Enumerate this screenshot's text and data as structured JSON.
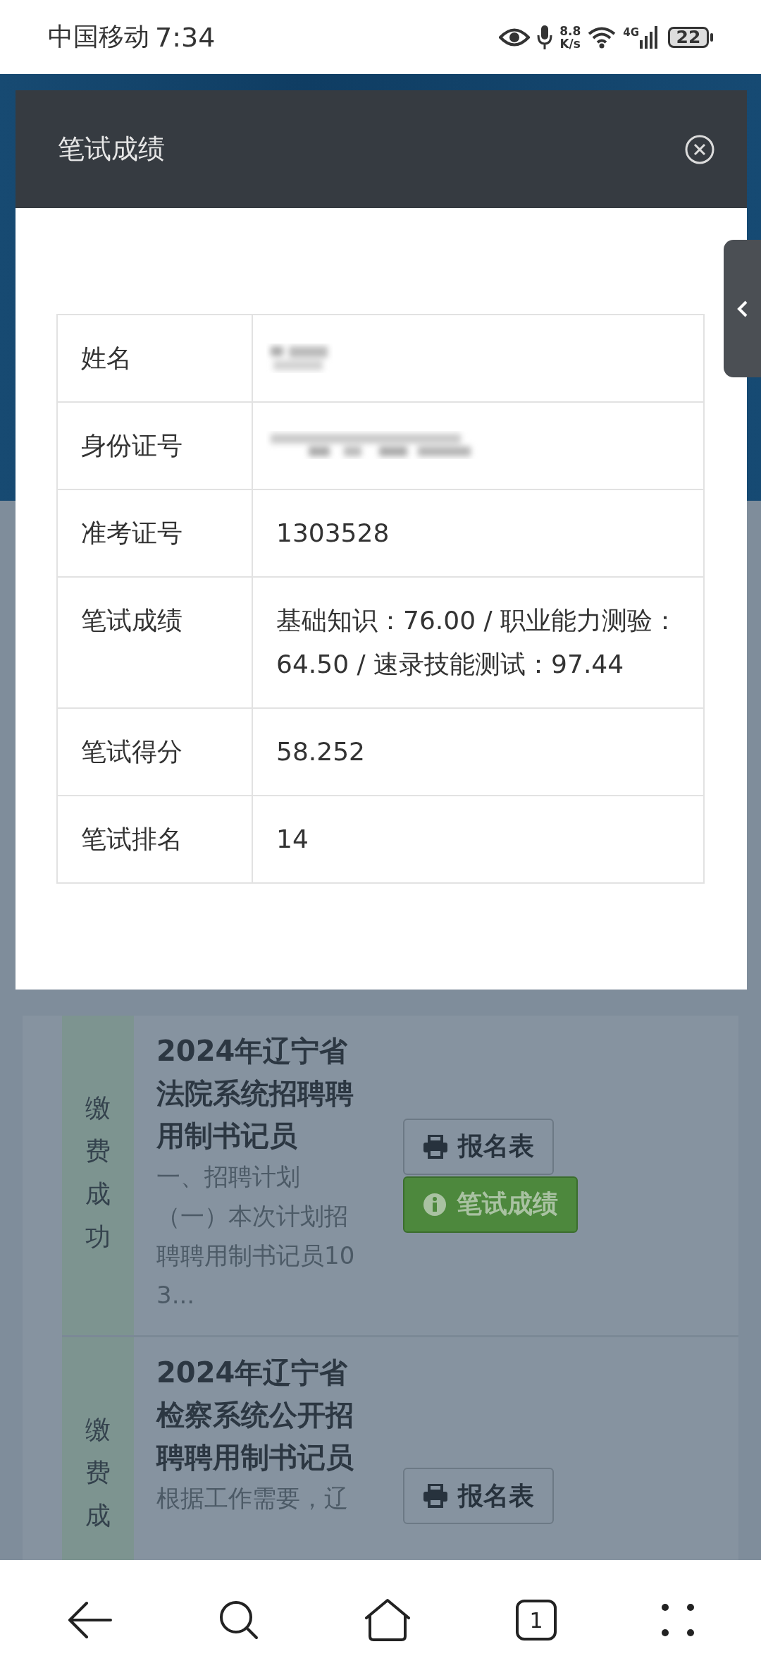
{
  "status_bar": {
    "carrier": "中国移动",
    "time": "7:34",
    "net_speed_value": "8.8",
    "net_speed_unit": "K/s",
    "network": "4G",
    "battery": "22"
  },
  "modal": {
    "title": "笔试成绩",
    "rows": [
      {
        "label": "姓名",
        "redacted": true
      },
      {
        "label": "身份证号",
        "redacted": true
      },
      {
        "label": "准考证号",
        "redacted": false,
        "value": "1303528"
      },
      {
        "label": "笔试成绩",
        "redacted": false,
        "value": "基础知识：76.00 / 职业能力测验：64.50 / 速录技能测试：97.44"
      },
      {
        "label": "笔试得分",
        "redacted": false,
        "value": "58.252"
      },
      {
        "label": "笔试排名",
        "redacted": false,
        "value": "14"
      }
    ]
  },
  "applications": [
    {
      "status": "缴费成功",
      "title": "2024年辽宁省法院系统招聘聘用制书记员",
      "description": [
        "一、招聘计划",
        "（一）本次计划招聘聘用制书记员103..."
      ],
      "buttons": [
        {
          "kind": "form",
          "label": "报名表"
        },
        {
          "kind": "score",
          "label": "笔试成绩"
        }
      ]
    },
    {
      "status": "缴费成",
      "title": "2024年辽宁省检察系统公开招聘聘用制书记员",
      "description": [
        "根据工作需要，辽"
      ],
      "buttons": [
        {
          "kind": "form",
          "label": "报名表"
        }
      ]
    }
  ],
  "nav": {
    "tab_count": "1"
  }
}
